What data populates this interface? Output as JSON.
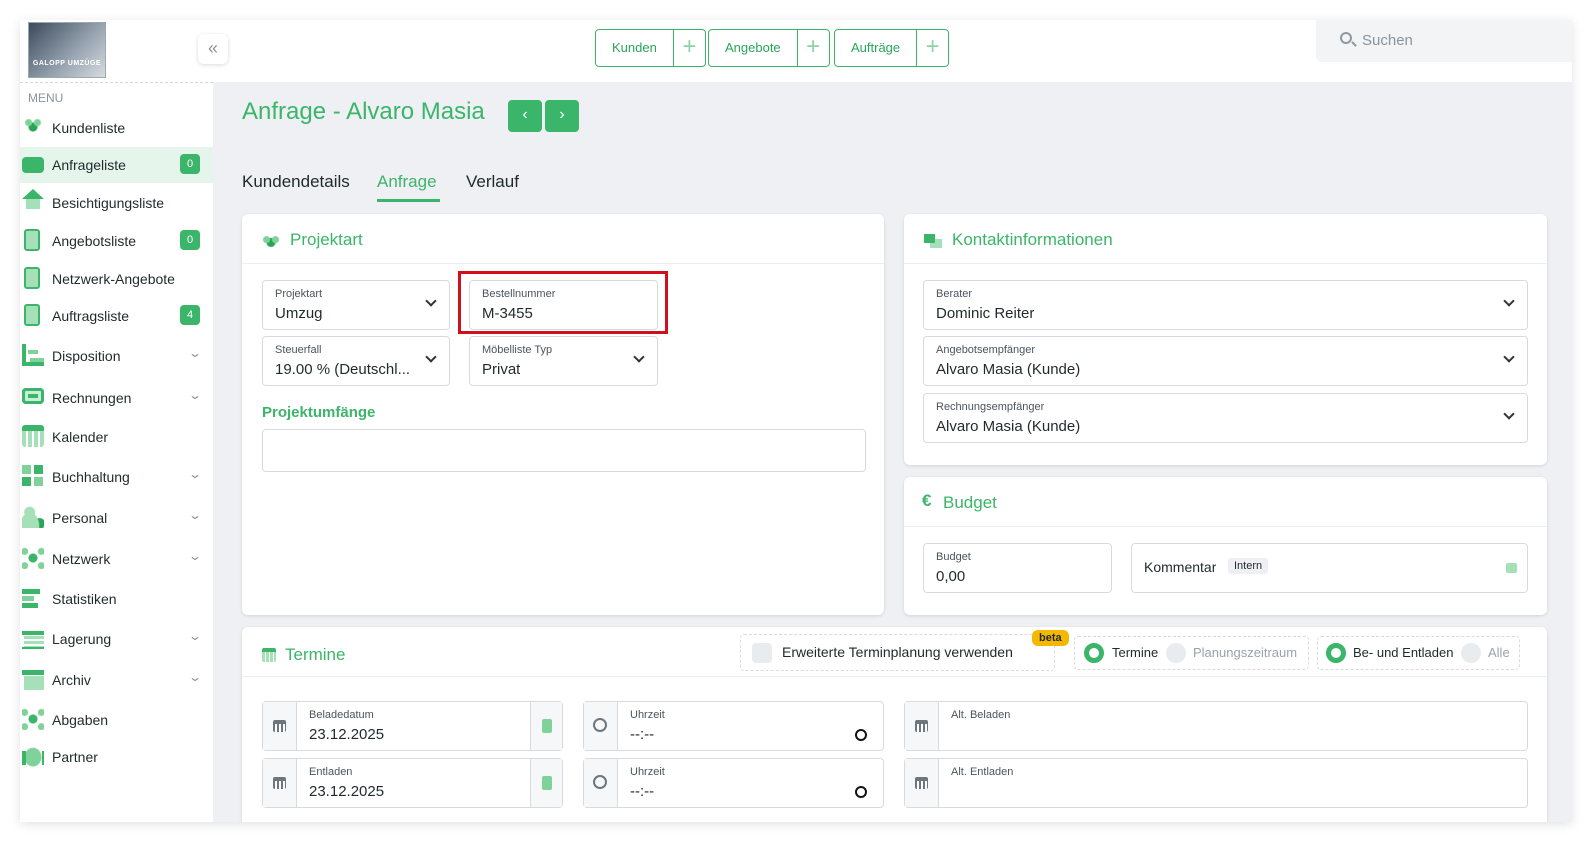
{
  "header": {
    "logo_text": "GALOPP UMZÜGE",
    "collapse_icon": "«",
    "quick_actions": [
      {
        "label": "Kunden",
        "plus": "+"
      },
      {
        "label": "Angebote",
        "plus": "+"
      },
      {
        "label": "Aufträge",
        "plus": "+"
      }
    ],
    "search_placeholder": "Suchen"
  },
  "sidebar": {
    "menu_title": "MENU",
    "items": [
      {
        "label": "Kundenliste",
        "icon": "people-icon"
      },
      {
        "label": "Anfrageliste",
        "icon": "tray-icon",
        "badge": "0",
        "active": true
      },
      {
        "label": "Besichtigungsliste",
        "icon": "house-icon"
      },
      {
        "label": "Angebotsliste",
        "icon": "document-icon",
        "badge": "0"
      },
      {
        "label": "Netzwerk-Angebote",
        "icon": "document-icon"
      },
      {
        "label": "Auftragsliste",
        "icon": "document-icon",
        "badge": "4"
      },
      {
        "label": "Disposition",
        "icon": "bars-icon",
        "expandable": true
      },
      {
        "label": "Rechnungen",
        "icon": "money-icon",
        "expandable": true
      },
      {
        "label": "Kalender",
        "icon": "calendar-icon"
      },
      {
        "label": "Buchhaltung",
        "icon": "grid-icon",
        "expandable": true
      },
      {
        "label": "Personal",
        "icon": "person-icon",
        "expandable": true
      },
      {
        "label": "Netzwerk",
        "icon": "network-icon",
        "expandable": true
      },
      {
        "label": "Statistiken",
        "icon": "stats-icon"
      },
      {
        "label": "Lagerung",
        "icon": "storage-icon",
        "expandable": true
      },
      {
        "label": "Archiv",
        "icon": "archive-icon",
        "expandable": true
      },
      {
        "label": "Abgaben",
        "icon": "network-icon"
      },
      {
        "label": "Partner",
        "icon": "handshake-icon"
      }
    ]
  },
  "page": {
    "title": "Anfrage - Alvaro Masia",
    "prev": "‹",
    "next": "›",
    "tabs": [
      {
        "label": "Kundendetails"
      },
      {
        "label": "Anfrage",
        "active": true
      },
      {
        "label": "Verlauf"
      }
    ]
  },
  "projektart": {
    "title": "Projektart",
    "fields": {
      "projektart": {
        "label": "Projektart",
        "value": "Umzug"
      },
      "bestellnummer": {
        "label": "Bestellnummer",
        "value": "M-3455"
      },
      "steuerfall": {
        "label": "Steuerfall",
        "value": "19.00 % (Deutschl..."
      },
      "moebelliste": {
        "label": "Möbelliste Typ",
        "value": "Privat"
      }
    },
    "umfaenge_label": "Projektumfänge"
  },
  "kontakt": {
    "title": "Kontaktinformationen",
    "fields": {
      "berater": {
        "label": "Berater",
        "value": "Dominic Reiter"
      },
      "angebot": {
        "label": "Angebotsempfänger",
        "value": "Alvaro Masia (Kunde)"
      },
      "rechnung": {
        "label": "Rechnungsempfänger",
        "value": "Alvaro Masia (Kunde)"
      }
    }
  },
  "budget": {
    "title": "Budget",
    "currency": "€",
    "field": {
      "label": "Budget",
      "value": "0,00"
    },
    "kommentar_label": "Kommentar",
    "intern_badge": "Intern"
  },
  "termine": {
    "title": "Termine",
    "erweitert_label": "Erweiterte Terminplanung verwenden",
    "beta": "beta",
    "mode_radios": [
      {
        "label": "Termine",
        "selected": true
      },
      {
        "label": "Planungszeitraum",
        "selected": false
      }
    ],
    "filter_radios": [
      {
        "label": "Be- und Entladen",
        "selected": true
      },
      {
        "label": "Alle",
        "selected": false
      }
    ],
    "rows": [
      {
        "date_label": "Beladedatum",
        "date_value": "23.12.2025",
        "time_label": "Uhrzeit",
        "time_value": "--:--",
        "alt_label": "Alt. Beladen"
      },
      {
        "date_label": "Entladen",
        "date_value": "23.12.2025",
        "time_label": "Uhrzeit",
        "time_value": "--:--",
        "alt_label": "Alt. Entladen"
      }
    ]
  },
  "colors": {
    "accent": "#3bb56a",
    "highlight": "#d0101c",
    "beta": "#f5b800"
  }
}
